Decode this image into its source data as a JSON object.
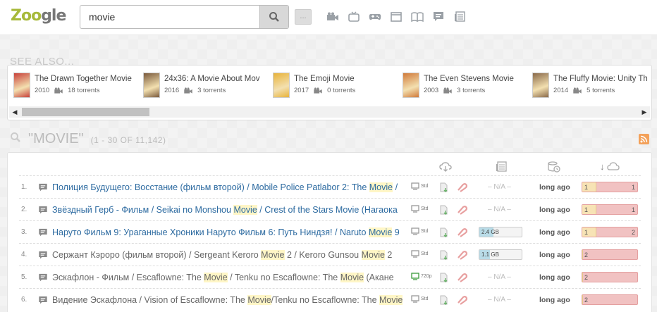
{
  "logo": {
    "text_a": "Zoo",
    "text_b": "gle"
  },
  "search": {
    "value": "movie",
    "more_label": "..."
  },
  "categories": [
    "video-icon",
    "tv-icon",
    "games-icon",
    "software-icon",
    "books-icon",
    "chat-icon",
    "news-icon"
  ],
  "see_also": {
    "title": "SEE ALSO...",
    "items": [
      {
        "title": "The Drawn Together Movie",
        "year": "2010",
        "torrents": "18 torrents",
        "color": "#c8413a"
      },
      {
        "title": "24x36: A Movie About Mov",
        "year": "2016",
        "torrents": "3 torrents",
        "color": "#7a5a3c"
      },
      {
        "title": "The Emoji Movie",
        "year": "2017",
        "torrents": "0 torrents",
        "color": "#e8b33a"
      },
      {
        "title": "The Even Stevens Movie",
        "year": "2003",
        "torrents": "3 torrents",
        "color": "#d07a3a"
      },
      {
        "title": "The Fluffy Movie: Unity Th",
        "year": "2014",
        "torrents": "5 torrents",
        "color": "#8a6a4a"
      }
    ]
  },
  "results_header": {
    "query": "\"MOVIE\"",
    "count": "(1 - 30 OF 11,142)"
  },
  "results": [
    {
      "num": "1.",
      "pre": "Полиция Будущего: Восстание (фильм второй) / Mobile Police Patlabor 2: The ",
      "hl": "Movie",
      "post": " / ",
      "color": "blue",
      "quality": "Std",
      "size": null,
      "na": "– N/A –",
      "age": "long ago",
      "seeds": "1",
      "leech": "1"
    },
    {
      "num": "2.",
      "pre": "Звёздный Герб - Фильм / Seikai no Monshou ",
      "hl": "Movie",
      "post": " / Crest of the Stars Movie (Нагаока",
      "color": "blue",
      "quality": "Std",
      "size": null,
      "na": "– N/A –",
      "age": "long ago",
      "seeds": "1",
      "leech": "1"
    },
    {
      "num": "3.",
      "pre": "Наруто Фильм 9: Ураганные Хроники Наруто Фильм 6: Путь Ниндзя! / Naruto ",
      "hl": "Movie",
      "post": " 9",
      "color": "blue",
      "quality": "Std",
      "size": "2.4 GB",
      "size_frac": 0.33,
      "na": "",
      "age": "long ago",
      "seeds": "1",
      "leech": "2"
    },
    {
      "num": "4.",
      "pre": "Сержант Кэроро (фильм второй) / Sergeant Keroro ",
      "hl": "Movie",
      "post": " 2 / Keroro Gunsou ",
      "hl2": "Movie",
      "post2": " 2",
      "color": "gray",
      "quality": "Std",
      "size": "1.1 GB",
      "size_frac": 0.25,
      "na": "",
      "age": "long ago",
      "seeds": "2",
      "leech": ""
    },
    {
      "num": "5.",
      "pre": "Эскафлон - Фильм / Escaflowne: The ",
      "hl": "Movie",
      "post": " / Tenku no Escaflowne: The ",
      "hl2": "Movie",
      "post2": " (Акане",
      "color": "gray",
      "quality": "720p",
      "size": null,
      "na": "– N/A –",
      "age": "long ago",
      "seeds": "2",
      "leech": ""
    },
    {
      "num": "6.",
      "pre": "Видение Эскафлона / Vision of Escaflowne: The ",
      "hl": "Movie",
      "post": "/Tenku no Escaflowne: The ",
      "hl2": "Movie",
      "post2": "",
      "color": "gray",
      "quality": "Std",
      "size": null,
      "na": "– N/A –",
      "age": "long ago",
      "seeds": "2",
      "leech": ""
    }
  ]
}
